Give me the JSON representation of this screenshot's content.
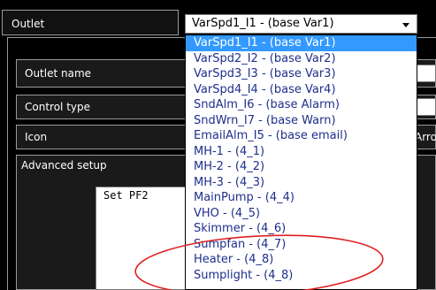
{
  "outlet": {
    "label": "Outlet",
    "selected": "VarSpd1_I1 - (base Var1)"
  },
  "fields": {
    "outlet_name_label": "Outlet name",
    "control_type_label": "Control type",
    "icon_label": "Icon",
    "icon_value_partial": "Arro",
    "advanced_setup_label": "Advanced setup"
  },
  "advanced_text": "Set PF2",
  "dropdown": {
    "options": [
      "VarSpd1_I1 - (base Var1)",
      "VarSpd2_I2 - (base Var2)",
      "VarSpd3_I3 - (base Var3)",
      "VarSpd4_I4 - (base Var4)",
      "SndAlm_I6 - (base Alarm)",
      "SndWrn_I7 - (base Warn)",
      "EmailAlm_I5 - (base email)",
      "MH-1 - (4_1)",
      "MH-2 - (4_2)",
      "MH-3 - (4_3)",
      "MainPump - (4_4)",
      "VHO - (4_5)",
      "Skimmer - (4_6)",
      "Sumpfan - (4_7)",
      "Heater - (4_8)",
      "Sumplight - (4_8)"
    ],
    "selected_index": 0
  },
  "colors": {
    "panel_bg": "#000000",
    "selection_bg": "#3399ff",
    "option_text": "#1e2f8c",
    "annotation": "#e02020"
  }
}
